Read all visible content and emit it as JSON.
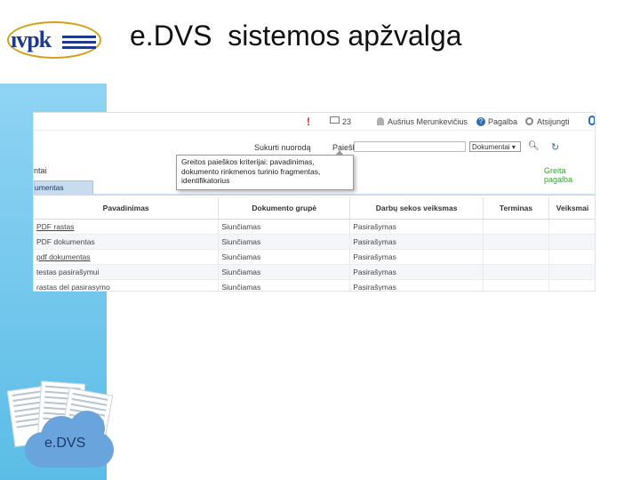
{
  "slide": {
    "title": "e.DVS  sistemos apžvalga",
    "logo_text": "ıvpk",
    "cloud_label": "e.DVS"
  },
  "app": {
    "topbar": {
      "notifications_count": "23",
      "user_name": "Aušrius Merunkevičius",
      "help_label": "Pagalba",
      "logout_label": "Atsijungti"
    },
    "toolbar": {
      "create_link_label": "Sukurti nuorodą",
      "search_label": "Paieška",
      "search_value": "",
      "search_scope": "Dokumentai ▾"
    },
    "tooltip": "Greitos paieškos kriterijai: pavadinimas, dokumento rinkmenos turinio fragmentas, identifikatorius",
    "section_label": "ntai",
    "quick_help_label": "Greita pagalba",
    "tab_label": "umentas",
    "table": {
      "headers": [
        "Pavadinimas",
        "Dokumento grupė",
        "Darbų sekos veiksmas",
        "Terminas",
        "Veiksmai"
      ],
      "rows": [
        [
          "PDF rastas",
          "Siunčiamas",
          "Pasirašymas",
          "",
          ""
        ],
        [
          "PDF dokumentas",
          "Siunčiamas",
          "Pasirašymas",
          "",
          ""
        ],
        [
          "pdf dokumentas",
          "Siunčiamas",
          "Pasirašymas",
          "",
          ""
        ],
        [
          "testas pasirašymui",
          "Siunčiamas",
          "Pasirašymas",
          "",
          ""
        ],
        [
          "rastas del pasirasymo",
          "Siunčiamas",
          "Pasirašymas",
          "",
          ""
        ]
      ]
    }
  },
  "colors": {
    "band": "#5bbde6",
    "accent": "#2f6db5",
    "tab": "#c9dbee",
    "quick_help": "#3a9a3a",
    "alert": "#d9232d"
  },
  "icons": [
    "alert-icon",
    "mail-icon",
    "user-icon",
    "help-icon",
    "power-icon",
    "search-icon",
    "refresh-icon",
    "document-icon",
    "cloud-icon"
  ]
}
